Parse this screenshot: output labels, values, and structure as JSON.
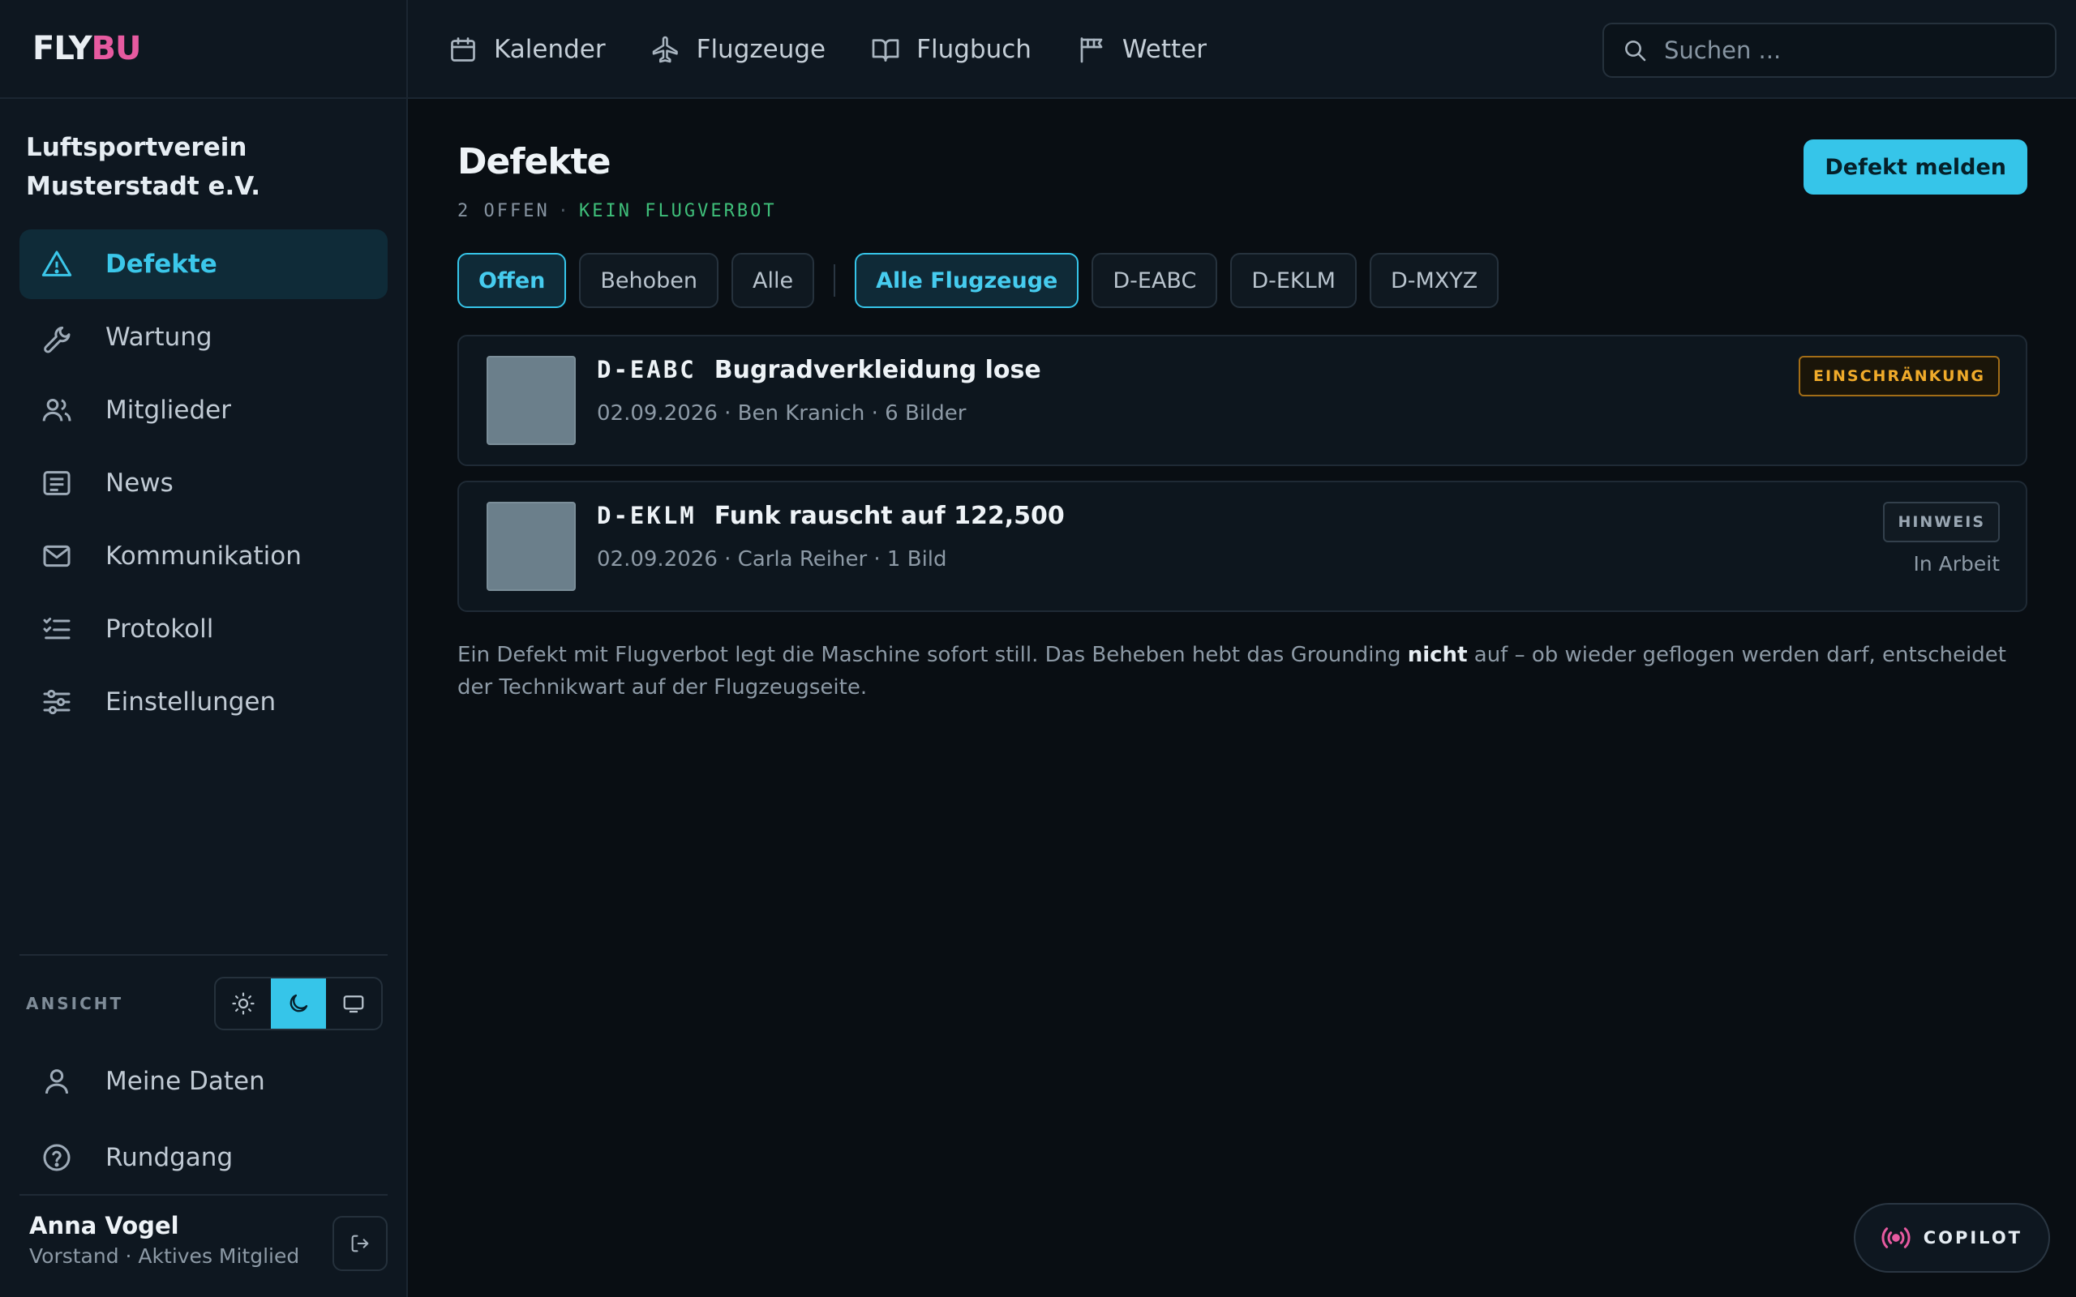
{
  "app": {
    "logo_part1": "FLY",
    "logo_part2": "BU"
  },
  "sidebar": {
    "org_name": "Luftsportverein Musterstadt e.V.",
    "items": [
      {
        "label": "Defekte",
        "icon": "warning-icon",
        "active": true
      },
      {
        "label": "Wartung",
        "icon": "wrench-icon"
      },
      {
        "label": "Mitglieder",
        "icon": "users-icon"
      },
      {
        "label": "News",
        "icon": "newspaper-icon"
      },
      {
        "label": "Kommunikation",
        "icon": "mail-icon"
      },
      {
        "label": "Protokoll",
        "icon": "list-check-icon"
      },
      {
        "label": "Einstellungen",
        "icon": "sliders-icon"
      }
    ],
    "view_label": "ANSICHT",
    "theme_options": [
      "light",
      "dark",
      "system"
    ],
    "theme_selected": "dark",
    "links": [
      {
        "label": "Meine Daten",
        "icon": "user-icon"
      },
      {
        "label": "Rundgang",
        "icon": "help-circle-icon"
      }
    ],
    "user": {
      "name": "Anna Vogel",
      "role": "Vorstand · Aktives Mitglied"
    }
  },
  "topnav": {
    "items": [
      {
        "label": "Kalender",
        "icon": "calendar-icon"
      },
      {
        "label": "Flugzeuge",
        "icon": "plane-icon"
      },
      {
        "label": "Flugbuch",
        "icon": "book-icon"
      },
      {
        "label": "Wetter",
        "icon": "windsock-icon"
      }
    ],
    "search_placeholder": "Suchen ..."
  },
  "main": {
    "title": "Defekte",
    "count_text": "2 OFFEN",
    "status_text": "KEIN FLUGVERBOT",
    "report_button": "Defekt melden",
    "status_filters": [
      {
        "label": "Offen",
        "active": true
      },
      {
        "label": "Behoben"
      },
      {
        "label": "Alle"
      }
    ],
    "aircraft_filters": [
      {
        "label": "Alle Flugzeuge",
        "active": true
      },
      {
        "label": "D-EABC"
      },
      {
        "label": "D-EKLM"
      },
      {
        "label": "D-MXYZ"
      }
    ],
    "defects": [
      {
        "registration": "D-EABC",
        "title": "Bugradverkleidung lose",
        "meta": "02.09.2026 · Ben Kranich · 6 Bilder",
        "badge": "EINSCHRÄNKUNG",
        "severity": "warn",
        "state": ""
      },
      {
        "registration": "D-EKLM",
        "title": "Funk rauscht auf 122,500",
        "meta": "02.09.2026 · Carla Reiher · 1 Bild",
        "badge": "HINWEIS",
        "severity": "info",
        "state": "In Arbeit"
      }
    ],
    "note_part1": "Ein Defekt mit Flugverbot legt die Maschine sofort still. Das Beheben hebt das Grounding ",
    "note_bold": "nicht",
    "note_part2": " auf – ob wieder geflogen werden darf, entscheidet der Technikwart auf der Flugzeugseite."
  },
  "copilot": {
    "label": "COPILOT"
  },
  "colors": {
    "accent": "#36c5e9",
    "brand_pink": "#e65aa0",
    "ok": "#3fbf7a",
    "warn": "#f0ab2a"
  }
}
